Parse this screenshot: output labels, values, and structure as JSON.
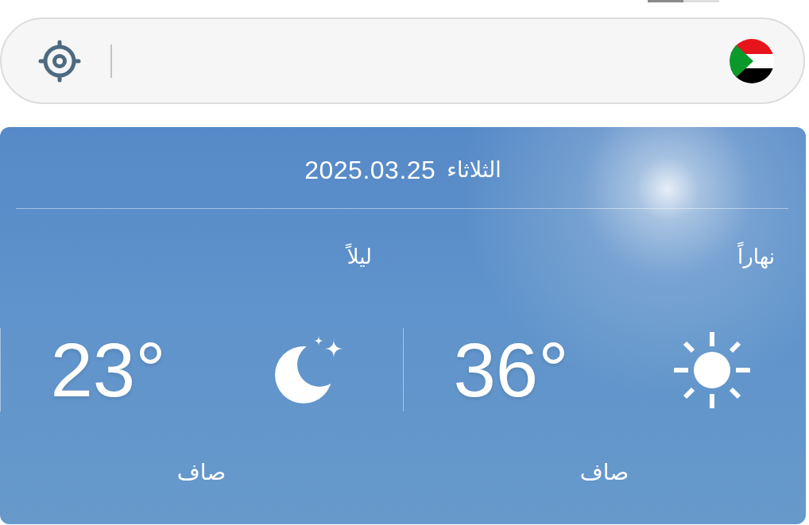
{
  "page_indicator": [
    {
      "selected": true
    },
    {
      "selected": false
    }
  ],
  "weather": {
    "weekday": "الثلاثاء",
    "date": "2025.03.25",
    "periods": [
      {
        "kind": "day",
        "label": "نهاراً",
        "temperature": "36°",
        "condition": "صاف"
      },
      {
        "kind": "night",
        "label": "ليلاً",
        "temperature": "23°",
        "condition": "صاف"
      }
    ]
  }
}
